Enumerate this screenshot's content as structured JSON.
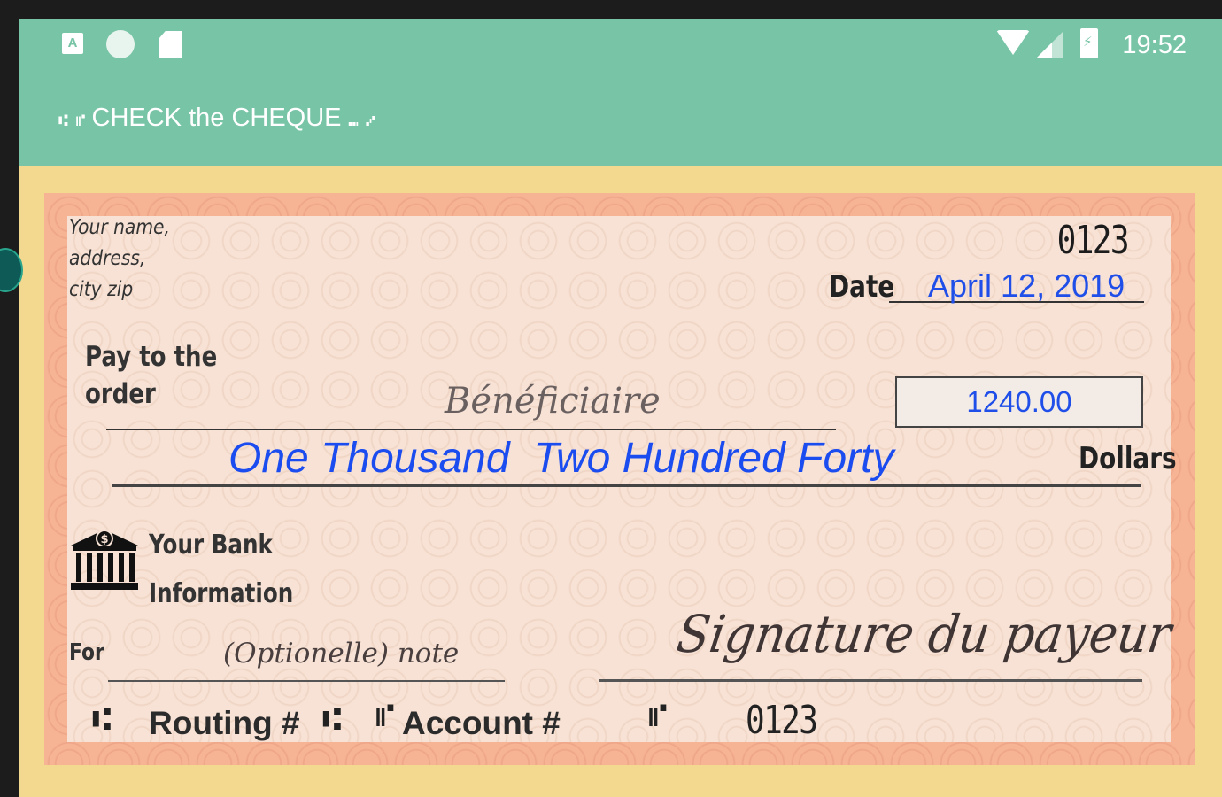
{
  "status_bar": {
    "time": "19:52",
    "notification_icons": [
      "a-icon",
      "circle-icon",
      "sd-card-icon"
    ],
    "system_icons": [
      "wifi-icon",
      "signal-icon",
      "battery-charging-icon"
    ]
  },
  "app_bar": {
    "title": "CHECK the CHEQUE",
    "title_prefix": "⑆ ⑈",
    "title_suffix": "⑉ ⑇",
    "color": "#78c4a6"
  },
  "cheque": {
    "payer_lines": [
      "Your name,",
      "address,",
      "city zip"
    ],
    "number": "0123",
    "date_label": "Date",
    "date_value": "April 12, 2019",
    "pay_to_label_lines": [
      "Pay to the",
      "order"
    ],
    "payee_placeholder": "Bénéficiaire",
    "amount_value": "1240.00",
    "amount_in_words": "One Thousand  Two Hundred Forty",
    "dollars_label": "Dollars",
    "bank_info_lines": [
      "Your Bank",
      "Information"
    ],
    "for_label": "For",
    "memo_placeholder": "(Optionelle) note",
    "signature_placeholder": "Signature du payeur",
    "micr": {
      "routing_label": "Routing #",
      "account_label": "Account #",
      "check_number": "0123",
      "symbol_transit": "⑆",
      "symbol_onus": "⑈"
    },
    "colors": {
      "border": "#f6b494",
      "face": "#f7e2d5",
      "background": "#f3d98f",
      "input_text": "#1f4fe8"
    }
  }
}
